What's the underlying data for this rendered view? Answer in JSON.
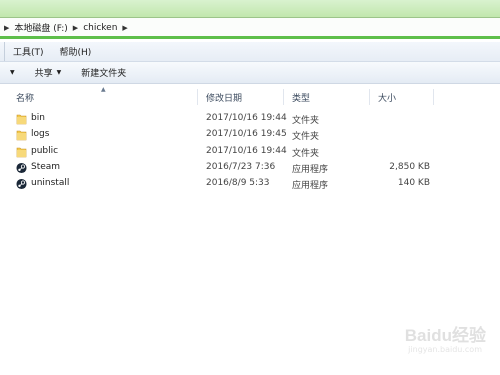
{
  "address": {
    "crumbs": [
      "本地磁盘 (F:)",
      "chicken"
    ]
  },
  "menu": {
    "items": [
      "工具(T)",
      "帮助(H)"
    ]
  },
  "toolbar": {
    "share_label": "共享",
    "new_folder_label": "新建文件夹"
  },
  "columns": {
    "name": "名称",
    "date": "修改日期",
    "type": "类型",
    "size": "大小"
  },
  "files": [
    {
      "name": "bin",
      "date": "2017/10/16 19:44",
      "type": "文件夹",
      "size": "",
      "icon": "folder-icon"
    },
    {
      "name": "logs",
      "date": "2017/10/16 19:45",
      "type": "文件夹",
      "size": "",
      "icon": "folder-icon"
    },
    {
      "name": "public",
      "date": "2017/10/16 19:44",
      "type": "文件夹",
      "size": "",
      "icon": "folder-icon"
    },
    {
      "name": "Steam",
      "date": "2016/7/23 7:36",
      "type": "应用程序",
      "size": "2,850 KB",
      "icon": "steam-icon"
    },
    {
      "name": "uninstall",
      "date": "2016/8/9 5:33",
      "type": "应用程序",
      "size": "140 KB",
      "icon": "steam-icon"
    }
  ],
  "watermark": {
    "text": "Baidu经验",
    "url": "jingyan.baidu.com"
  },
  "colors": {
    "accent_green": "#5ebf4a",
    "folder_yellow": "#f2c94c",
    "header_text": "#3b4a5e"
  }
}
